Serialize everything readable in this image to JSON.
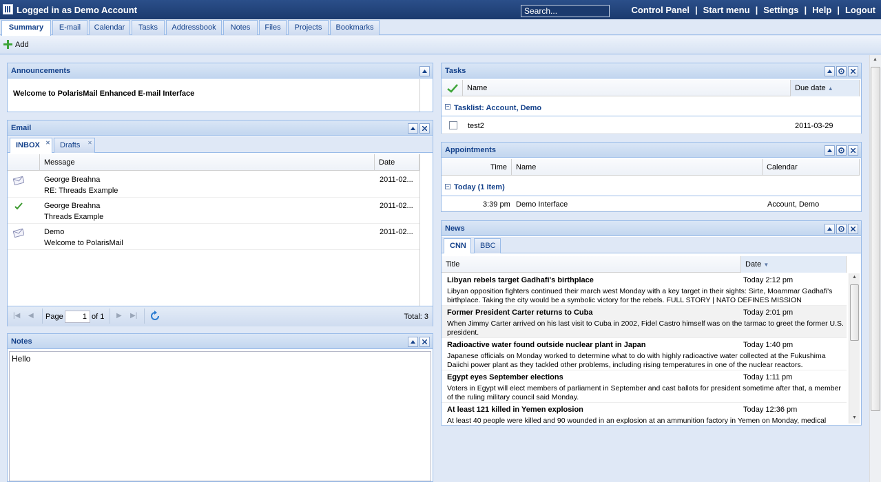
{
  "header": {
    "title": "Logged in as Demo Account",
    "search_placeholder": "Search...",
    "nav": [
      "Control Panel",
      "Start menu",
      "Settings",
      "Help",
      "Logout"
    ]
  },
  "tabs": [
    "Summary",
    "E-mail",
    "Calendar",
    "Tasks",
    "Addressbook",
    "Notes",
    "Files",
    "Projects",
    "Bookmarks"
  ],
  "toolbar": {
    "add_label": "Add"
  },
  "announcements": {
    "title": "Announcements",
    "text": "Welcome to PolarisMail Enhanced E-mail Interface"
  },
  "email": {
    "title": "Email",
    "tabs": [
      "INBOX",
      "Drafts"
    ],
    "columns": {
      "message": "Message",
      "date": "Date"
    },
    "rows": [
      {
        "icon": "envelope-icon",
        "from": "George Breahna",
        "subject": "RE: Threads Example",
        "date": "2011-02..."
      },
      {
        "icon": "replied-check-icon",
        "from": "George Breahna",
        "subject": "Threads Example",
        "date": "2011-02..."
      },
      {
        "icon": "envelope-icon",
        "from": "Demo",
        "subject": "Welcome to PolarisMail",
        "date": "2011-02..."
      }
    ],
    "pager": {
      "page_label": "Page",
      "page_value": "1",
      "of_label": "of 1",
      "total": "Total: 3"
    }
  },
  "notes": {
    "title": "Notes",
    "text": "Hello"
  },
  "tasks": {
    "title": "Tasks",
    "columns": {
      "name": "Name",
      "due": "Due date"
    },
    "group": "Tasklist: Account, Demo",
    "rows": [
      {
        "name": "test2",
        "due": "2011-03-29"
      }
    ]
  },
  "appointments": {
    "title": "Appointments",
    "columns": {
      "time": "Time",
      "name": "Name",
      "calendar": "Calendar"
    },
    "group": "Today (1 item)",
    "rows": [
      {
        "time": "3:39 pm",
        "name": "Demo Interface",
        "calendar": "Account, Demo"
      }
    ]
  },
  "news": {
    "title": "News",
    "tabs": [
      "CNN",
      "BBC"
    ],
    "columns": {
      "title": "Title",
      "date": "Date"
    },
    "items": [
      {
        "title": "Libyan rebels target Gadhafi's birthplace",
        "date": "Today 2:12 pm",
        "desc": "Libyan opposition fighters continued their march west Monday with a key target in their sights: Sirte, Moammar Gadhafi's birthplace. Taking the city would be a symbolic victory for the rebels. FULL STORY | NATO DEFINES MISSION"
      },
      {
        "title": "Former President Carter returns to Cuba",
        "date": "Today 2:01 pm",
        "desc": "When Jimmy Carter arrived on his last visit to Cuba in 2002, Fidel Castro himself was on the tarmac to greet the former U.S. president."
      },
      {
        "title": "Radioactive water found outside nuclear plant in Japan",
        "date": "Today 1:40 pm",
        "desc": "Japanese officials on Monday worked to determine what to do with highly radioactive water collected at the Fukushima Daiichi power plant as they tackled other problems, including rising temperatures in one of the nuclear reactors."
      },
      {
        "title": "Egypt eyes September elections",
        "date": "Today 1:11 pm",
        "desc": "Voters in Egypt will elect members of parliament in September and cast ballots for president sometime after that, a member of the ruling military council said Monday."
      },
      {
        "title": "At least 121 killed in Yemen explosion",
        "date": "Today 12:36 pm",
        "desc": "At least 40 people were killed and 90 wounded in an explosion at an ammunition factory in Yemen on Monday, medical"
      }
    ]
  }
}
